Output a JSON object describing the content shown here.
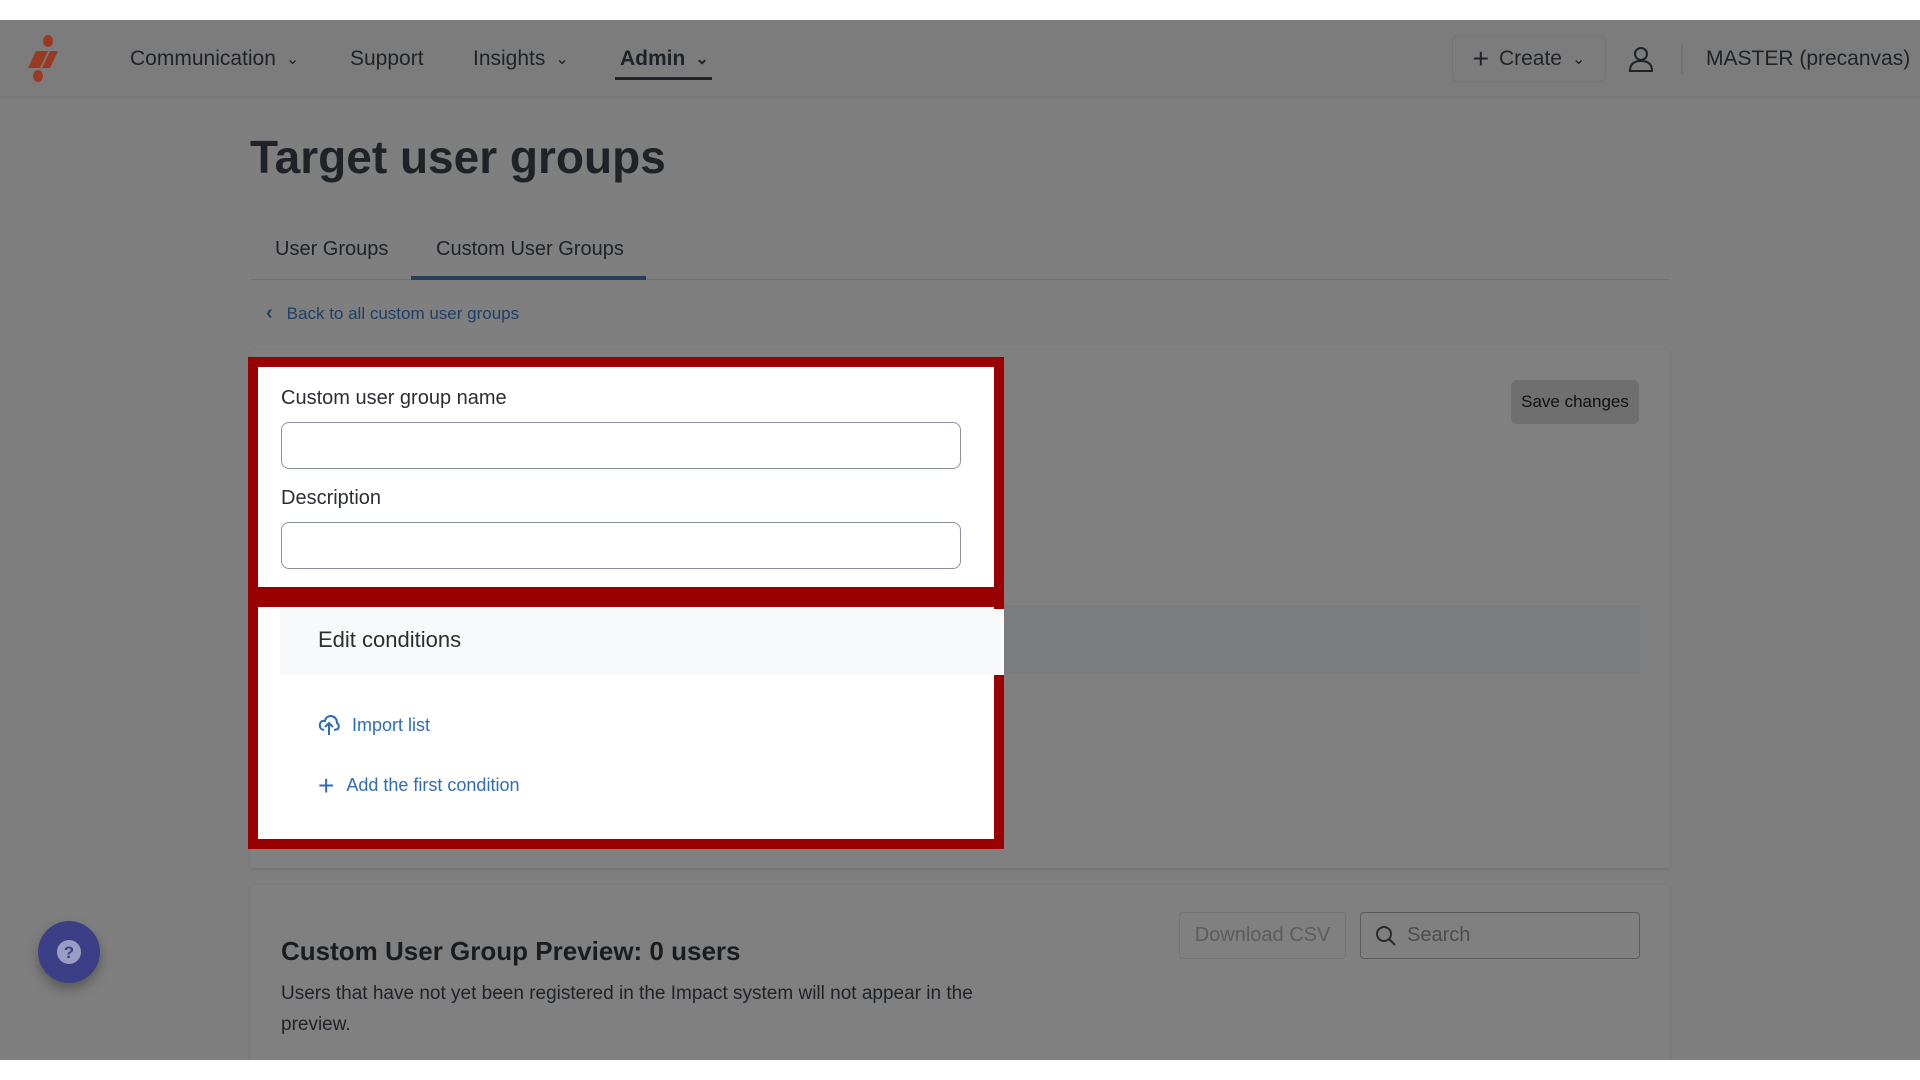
{
  "nav": {
    "items": [
      {
        "label": "Communication",
        "chevron": true
      },
      {
        "label": "Support"
      },
      {
        "label": "Insights",
        "chevron": true
      },
      {
        "label": "Admin",
        "chevron": true,
        "active": true
      }
    ],
    "create_label": "Create",
    "account_label": "MASTER (precanvas)"
  },
  "page": {
    "title": "Target user groups",
    "tabs": [
      "User Groups",
      "Custom User Groups"
    ],
    "active_tab": "Custom User Groups",
    "back_label": "Back to all custom user groups"
  },
  "form": {
    "name_label": "Custom user group name",
    "name_value": "",
    "description_label": "Description",
    "description_value": "",
    "save_label": "Save changes"
  },
  "conditions": {
    "title": "Edit conditions",
    "import_label": "Import list",
    "add_label": "Add the first condition"
  },
  "preview": {
    "title": "Custom User Group Preview: 0 users",
    "note": "Users that have not yet been registered in the Impact system will not appear in the preview.",
    "download_label": "Download CSV",
    "search_placeholder": "Search"
  },
  "colors": {
    "highlight": "#990000",
    "link": "#2f6db3",
    "logo": "#9b3a22",
    "help": "#3b3f86"
  }
}
